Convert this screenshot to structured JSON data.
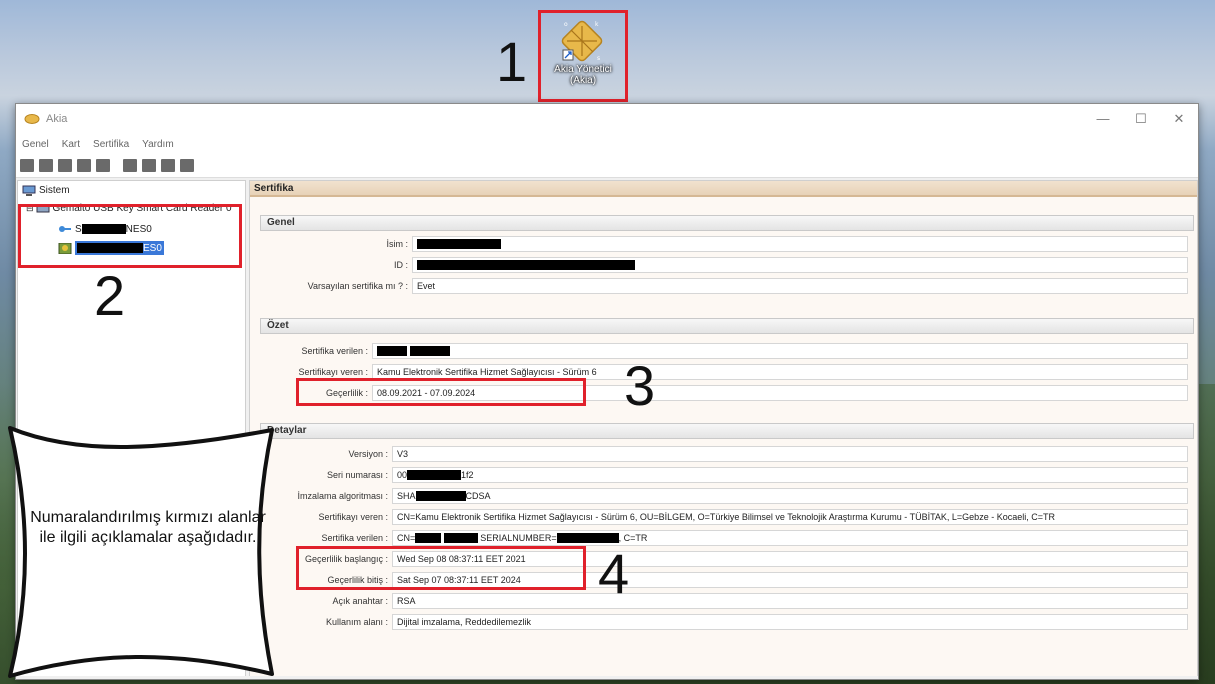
{
  "desktop": {
    "icon_label_line1": "Akia Yönetici",
    "icon_label_line2": "(Akia)"
  },
  "annotations": {
    "n1": "1",
    "n2": "2",
    "n3": "3",
    "n4": "4",
    "note": "Numaralandırılmış kırmızı alanlar ile ilgili açıklamalar aşağıdadır."
  },
  "window": {
    "title": "Akia",
    "minimize": "—",
    "maximize": "☐",
    "close": "✕",
    "menu": [
      "Genel",
      "Kart",
      "Sertifika",
      "Yardım"
    ]
  },
  "tree": {
    "root": "Sistem",
    "reader": "Gemalto USB Key Smart Card Reader 0",
    "item1_prefix": "S",
    "item1_suffix": "NES0",
    "item2_suffix": "ES0"
  },
  "panel": {
    "header": "Sertifika",
    "genel": {
      "title": "Genel",
      "isim_label": "İsim :",
      "id_label": "ID :",
      "varsayilan_label": "Varsayılan sertifika mı ? :",
      "varsayilan_value": "Evet"
    },
    "ozet": {
      "title": "Özet",
      "verilen_label": "Sertifika verilen :",
      "veren_label": "Sertifikayı veren :",
      "veren_value": "Kamu Elektronik Sertifika Hizmet Sağlayıcısı - Sürüm 6",
      "gecerlilik_label": "Geçerlilik :",
      "gecerlilik_value": "08.09.2021 - 07.09.2024"
    },
    "detay": {
      "title": "Detaylar",
      "versiyon_label": "Versiyon :",
      "versiyon_value": "V3",
      "seri_label": "Seri numarası :",
      "seri_prefix": "00",
      "seri_suffix": "1f2",
      "imza_label": "İmzalama algoritması :",
      "imza_prefix": "SHA",
      "imza_suffix": "CDSA",
      "veren_label": "Sertifikayı veren :",
      "veren_value": "CN=Kamu Elektronik Sertifika Hizmet Sağlayıcısı - Sürüm 6, OU=BİLGEM, O=Türkiye Bilimsel ve Teknolojik Araştırma Kurumu - TÜBİTAK, L=Gebze - Kocaeli, C=TR",
      "verilen_label": "Sertifika verilen :",
      "verilen_prefix": "CN=",
      "verilen_mid": "SERIALNUMBER=",
      "verilen_suffix": ", C=TR",
      "baslangic_label": "Geçerlilik başlangıç :",
      "baslangic_value": "Wed Sep 08 08:37:11 EET 2021",
      "bitis_label": "Geçerlilik bitiş :",
      "bitis_value": "Sat Sep 07 08:37:11 EET 2024",
      "anahtar_label": "Açık anahtar :",
      "anahtar_value": "RSA",
      "kullanim_label": "Kullanım alanı :",
      "kullanim_value": "Dijital imzalama, Reddedilemezlik"
    }
  },
  "colors": {
    "annotation_red": "#e0212b",
    "panel_header": "#e7d2b7"
  }
}
